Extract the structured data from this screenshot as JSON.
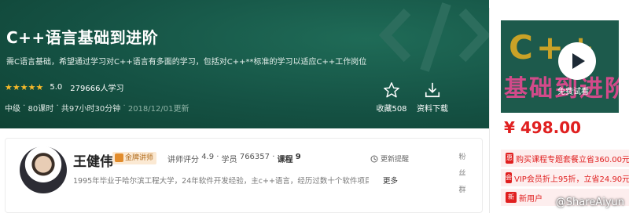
{
  "course": {
    "title": "C++语言基础到进阶",
    "description": "需C语言基础，希望通过学习对C++语言有多面的学习，包括对C++**标准的学习以适应C++工作岗位",
    "rating_score": "5.0",
    "students": "279666人学习",
    "rating_stars": 5,
    "level": "中级",
    "lessons": "80课时",
    "duration": "共97小时30分钟",
    "updated": "2018/12/01更新",
    "favorite_label": "收藏508",
    "download_label": "资料下载"
  },
  "sidebar": {
    "thumb_line1": "C++",
    "thumb_line2": "基础到进阶",
    "trial_label": "免费试看",
    "price": "¥ 498.00",
    "promos": [
      {
        "tag": "惠",
        "text": "购买课程专题套餐立省360.00元"
      },
      {
        "tag": "会",
        "text": "VIP会员折上95折，立省24.90元"
      },
      {
        "tag": "新",
        "text": "新用户"
      }
    ],
    "site_watermark": "@ShareAiyun"
  },
  "teacher": {
    "name": "王健伟",
    "badge": "金牌讲师",
    "rating_label": "讲师评分",
    "rating_value": "4.9",
    "students_label": "学员",
    "students_value": "766357",
    "courses_label": "课程",
    "courses_value": "9",
    "follow_label": "更新提醒",
    "bio": "1995年毕业于哈尔滨工程大学，24年软件开发经验，主c++语言，经历过数十个软件项目...",
    "more_label": "更多",
    "fans_group": "粉丝群"
  },
  "colors": {
    "hero_bg": "#155244",
    "price_red": "#e02020",
    "star": "#f7ba2a"
  }
}
